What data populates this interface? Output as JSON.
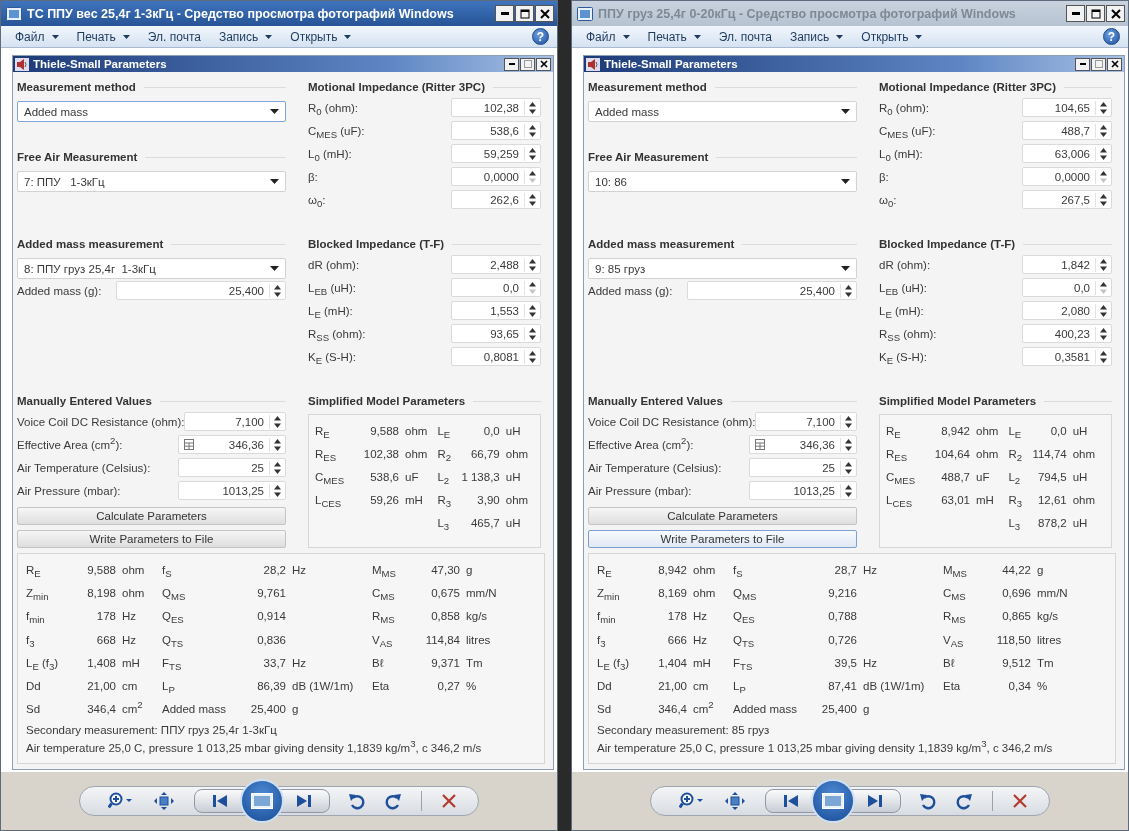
{
  "windows": [
    {
      "title": "ТС ППУ вес 25,4г 1-3кГц - Средство просмотра фотографий Windows",
      "active": true,
      "menu": [
        {
          "label": "Файл",
          "dropdown": true
        },
        {
          "label": "Печать",
          "dropdown": true
        },
        {
          "label": "Эл. почта",
          "dropdown": false
        },
        {
          "label": "Запись",
          "dropdown": true
        },
        {
          "label": "Открыть",
          "dropdown": true
        }
      ],
      "help": "?",
      "panel": {
        "title": "Thiele-Small Parameters",
        "method": {
          "heading": "Measurement method",
          "value": "Added mass",
          "focused": true
        },
        "free_air": {
          "heading": "Free Air Measurement",
          "value": "7: ППУ   1-3кГц",
          "focused": false
        },
        "added_mass": {
          "heading": "Added mass measurement",
          "value": "8: ППУ груз 25,4г  1-3кГц",
          "focused": false,
          "field": {
            "label": "Added mass (g):",
            "value": "25,400",
            "down_disabled": false
          }
        },
        "motional": {
          "heading": "Motional Impedance (Ritter 3PC)",
          "fields": [
            {
              "label": "R$_{0}$ (ohm):",
              "value": "102,38",
              "down_disabled": false
            },
            {
              "label": "C$_{MES}$ (uF):",
              "value": "538,6",
              "down_disabled": false
            },
            {
              "label": "L$_{0}$ (mH):",
              "value": "59,259",
              "down_disabled": false
            },
            {
              "label": "β:",
              "value": "0,0000",
              "down_disabled": true
            },
            {
              "label": "ω$_{0}$:",
              "value": "262,6",
              "down_disabled": false
            }
          ]
        },
        "blocked": {
          "heading": "Blocked Impedance (T-F)",
          "fields": [
            {
              "label": "dR (ohm):",
              "value": "2,488",
              "down_disabled": false
            },
            {
              "label": "L$_{EB}$ (uH):",
              "value": "0,0",
              "down_disabled": true
            },
            {
              "label": "L$_{E}$ (mH):",
              "value": "1,553",
              "down_disabled": false
            },
            {
              "label": "R$_{SS}$ (ohm):",
              "value": "93,65",
              "down_disabled": false
            },
            {
              "label": "K$_{E}$ (S-H):",
              "value": "0,8081",
              "down_disabled": false
            }
          ]
        },
        "manual": {
          "heading": "Manually Entered Values",
          "fields": [
            {
              "label": "Voice Coil DC Resistance (ohm):",
              "value": "7,100",
              "calculator": false,
              "down_disabled": false
            },
            {
              "label": "Effective Area (cm$^{2}$):",
              "value": "346,36",
              "calculator": true,
              "down_disabled": false
            },
            {
              "label": "Air Temperature (Celsius):",
              "value": "25",
              "calculator": false,
              "down_disabled": false
            },
            {
              "label": "Air Pressure (mbar):",
              "value": "1013,25",
              "calculator": false,
              "down_disabled": false
            }
          ],
          "buttons": [
            {
              "label": "Calculate Parameters",
              "focused": false
            },
            {
              "label": "Write Parameters to File",
              "focused": false
            }
          ]
        },
        "simplified": {
          "heading": "Simplified Model Parameters",
          "columns": [
            [
              {
                "symbol": "R$_{E}$",
                "value": "9,588",
                "unit": "ohm"
              },
              {
                "symbol": "R$_{ES}$",
                "value": "102,38",
                "unit": "ohm"
              },
              {
                "symbol": "C$_{MES}$",
                "value": "538,6",
                "unit": "uF"
              },
              {
                "symbol": "L$_{CES}$",
                "value": "59,26",
                "unit": "mH"
              }
            ],
            [
              {
                "symbol": "L$_{E}$",
                "value": "0,0",
                "unit": "uH"
              },
              {
                "symbol": "R$_{2}$",
                "value": "66,79",
                "unit": "ohm"
              },
              {
                "symbol": "L$_{2}$",
                "value": "1 138,3",
                "unit": "uH"
              },
              {
                "symbol": "R$_{3}$",
                "value": "3,90",
                "unit": "ohm"
              },
              {
                "symbol": "L$_{3}$",
                "value": "465,7",
                "unit": "uH"
              }
            ]
          ]
        },
        "results": {
          "columns": [
            [
              {
                "symbol": "R$_{E}$",
                "value": "9,588",
                "unit": "ohm"
              },
              {
                "symbol": "Z$_{min}$",
                "value": "8,198",
                "unit": "ohm"
              },
              {
                "symbol": "f$_{min}$",
                "value": "178",
                "unit": "Hz"
              },
              {
                "symbol": "f$_{3}$",
                "value": "668",
                "unit": "Hz"
              },
              {
                "symbol": "L$_{E}$ (f$_{3}$)",
                "value": "1,408",
                "unit": "mH"
              },
              {
                "symbol": "Dd",
                "value": "21,00",
                "unit": "cm"
              },
              {
                "symbol": "Sd",
                "value": "346,4",
                "unit": "cm$^{2}$"
              }
            ],
            [
              {
                "symbol": "f$_{S}$",
                "value": "28,2",
                "unit": "Hz"
              },
              {
                "symbol": "Q$_{MS}$",
                "value": "9,761"
              },
              {
                "symbol": "Q$_{ES}$",
                "value": "0,914"
              },
              {
                "symbol": "Q$_{TS}$",
                "value": "0,836"
              },
              {
                "symbol": "F$_{TS}$",
                "value": "33,7",
                "unit": "Hz"
              },
              {
                "symbol": "L$_{P}$",
                "value": "86,39",
                "unit": "dB (1W/1m)"
              },
              {
                "symbol": "Added mass",
                "value": "25,400",
                "unit": "g"
              }
            ],
            [
              {
                "symbol": "M$_{MS}$",
                "value": "47,30",
                "unit": "g"
              },
              {
                "symbol": "C$_{MS}$",
                "value": "0,675",
                "unit": "mm/N"
              },
              {
                "symbol": "R$_{MS}$",
                "value": "0,858",
                "unit": "kg/s"
              },
              {
                "symbol": "V$_{AS}$",
                "value": "114,84",
                "unit": "litres"
              },
              {
                "symbol": "Bℓ",
                "value": "9,371",
                "unit": "Tm"
              },
              {
                "symbol": "Eta",
                "value": "0,27",
                "unit": "%"
              }
            ]
          ],
          "notes": [
            "Secondary measurement: ППУ груз 25,4г 1-3кГц",
            "Air temperature 25,0 C, pressure 1 013,25 mbar giving density 1,1839 kg/m$^{3}$, c 346,2 m/s"
          ]
        }
      }
    },
    {
      "title": "ППУ груз 25,4г  0-20кГц - Средство просмотра фотографий Windows",
      "active": false,
      "menu": [
        {
          "label": "Файл",
          "dropdown": true
        },
        {
          "label": "Печать",
          "dropdown": true
        },
        {
          "label": "Эл. почта",
          "dropdown": false
        },
        {
          "label": "Запись",
          "dropdown": true
        },
        {
          "label": "Открыть",
          "dropdown": true
        }
      ],
      "help": "?",
      "panel": {
        "title": "Thiele-Small Parameters",
        "method": {
          "heading": "Measurement method",
          "value": "Added mass",
          "focused": false
        },
        "free_air": {
          "heading": "Free Air Measurement",
          "value": "10: 86",
          "focused": false
        },
        "added_mass": {
          "heading": "Added mass measurement",
          "value": "9: 85 груз",
          "focused": false,
          "field": {
            "label": "Added mass (g):",
            "value": "25,400",
            "down_disabled": false
          }
        },
        "motional": {
          "heading": "Motional Impedance (Ritter 3PC)",
          "fields": [
            {
              "label": "R$_{0}$ (ohm):",
              "value": "104,65",
              "down_disabled": false
            },
            {
              "label": "C$_{MES}$ (uF):",
              "value": "488,7",
              "down_disabled": false
            },
            {
              "label": "L$_{0}$ (mH):",
              "value": "63,006",
              "down_disabled": false
            },
            {
              "label": "β:",
              "value": "0,0000",
              "down_disabled": true
            },
            {
              "label": "ω$_{0}$:",
              "value": "267,5",
              "down_disabled": false
            }
          ]
        },
        "blocked": {
          "heading": "Blocked Impedance (T-F)",
          "fields": [
            {
              "label": "dR (ohm):",
              "value": "1,842",
              "down_disabled": false
            },
            {
              "label": "L$_{EB}$ (uH):",
              "value": "0,0",
              "down_disabled": true
            },
            {
              "label": "L$_{E}$ (mH):",
              "value": "2,080",
              "down_disabled": false
            },
            {
              "label": "R$_{SS}$ (ohm):",
              "value": "400,23",
              "down_disabled": false
            },
            {
              "label": "K$_{E}$ (S-H):",
              "value": "0,3581",
              "down_disabled": false
            }
          ]
        },
        "manual": {
          "heading": "Manually Entered Values",
          "fields": [
            {
              "label": "Voice Coil DC Resistance (ohm):",
              "value": "7,100",
              "calculator": false,
              "down_disabled": false
            },
            {
              "label": "Effective Area (cm$^{2}$):",
              "value": "346,36",
              "calculator": true,
              "down_disabled": false
            },
            {
              "label": "Air Temperature (Celsius):",
              "value": "25",
              "calculator": false,
              "down_disabled": false
            },
            {
              "label": "Air Pressure (mbar):",
              "value": "1013,25",
              "calculator": false,
              "down_disabled": false
            }
          ],
          "buttons": [
            {
              "label": "Calculate Parameters",
              "focused": false
            },
            {
              "label": "Write Parameters to File",
              "focused": true
            }
          ]
        },
        "simplified": {
          "heading": "Simplified Model Parameters",
          "columns": [
            [
              {
                "symbol": "R$_{E}$",
                "value": "8,942",
                "unit": "ohm"
              },
              {
                "symbol": "R$_{ES}$",
                "value": "104,64",
                "unit": "ohm"
              },
              {
                "symbol": "C$_{MES}$",
                "value": "488,7",
                "unit": "uF"
              },
              {
                "symbol": "L$_{CES}$",
                "value": "63,01",
                "unit": "mH"
              }
            ],
            [
              {
                "symbol": "L$_{E}$",
                "value": "0,0",
                "unit": "uH"
              },
              {
                "symbol": "R$_{2}$",
                "value": "114,74",
                "unit": "ohm"
              },
              {
                "symbol": "L$_{2}$",
                "value": "794,5",
                "unit": "uH"
              },
              {
                "symbol": "R$_{3}$",
                "value": "12,61",
                "unit": "ohm"
              },
              {
                "symbol": "L$_{3}$",
                "value": "878,2",
                "unit": "uH"
              }
            ]
          ]
        },
        "results": {
          "columns": [
            [
              {
                "symbol": "R$_{E}$",
                "value": "8,942",
                "unit": "ohm"
              },
              {
                "symbol": "Z$_{min}$",
                "value": "8,169",
                "unit": "ohm"
              },
              {
                "symbol": "f$_{min}$",
                "value": "178",
                "unit": "Hz"
              },
              {
                "symbol": "f$_{3}$",
                "value": "666",
                "unit": "Hz"
              },
              {
                "symbol": "L$_{E}$ (f$_{3}$)",
                "value": "1,404",
                "unit": "mH"
              },
              {
                "symbol": "Dd",
                "value": "21,00",
                "unit": "cm"
              },
              {
                "symbol": "Sd",
                "value": "346,4",
                "unit": "cm$^{2}$"
              }
            ],
            [
              {
                "symbol": "f$_{S}$",
                "value": "28,7",
                "unit": "Hz"
              },
              {
                "symbol": "Q$_{MS}$",
                "value": "9,216"
              },
              {
                "symbol": "Q$_{ES}$",
                "value": "0,788"
              },
              {
                "symbol": "Q$_{TS}$",
                "value": "0,726"
              },
              {
                "symbol": "F$_{TS}$",
                "value": "39,5",
                "unit": "Hz"
              },
              {
                "symbol": "L$_{P}$",
                "value": "87,41",
                "unit": "dB (1W/1m)"
              },
              {
                "symbol": "Added mass",
                "value": "25,400",
                "unit": "g"
              }
            ],
            [
              {
                "symbol": "M$_{MS}$",
                "value": "44,22",
                "unit": "g"
              },
              {
                "symbol": "C$_{MS}$",
                "value": "0,696",
                "unit": "mm/N"
              },
              {
                "symbol": "R$_{MS}$",
                "value": "0,865",
                "unit": "kg/s"
              },
              {
                "symbol": "V$_{AS}$",
                "value": "118,50",
                "unit": "litres"
              },
              {
                "symbol": "Bℓ",
                "value": "9,512",
                "unit": "Tm"
              },
              {
                "symbol": "Eta",
                "value": "0,34",
                "unit": "%"
              }
            ]
          ],
          "notes": [
            "Secondary measurement: 85 груз",
            "Air temperature 25,0 C, pressure 1 013,25 mbar giving density 1,1839 kg/m$^{3}$, c 346,2 m/s"
          ]
        }
      }
    }
  ]
}
